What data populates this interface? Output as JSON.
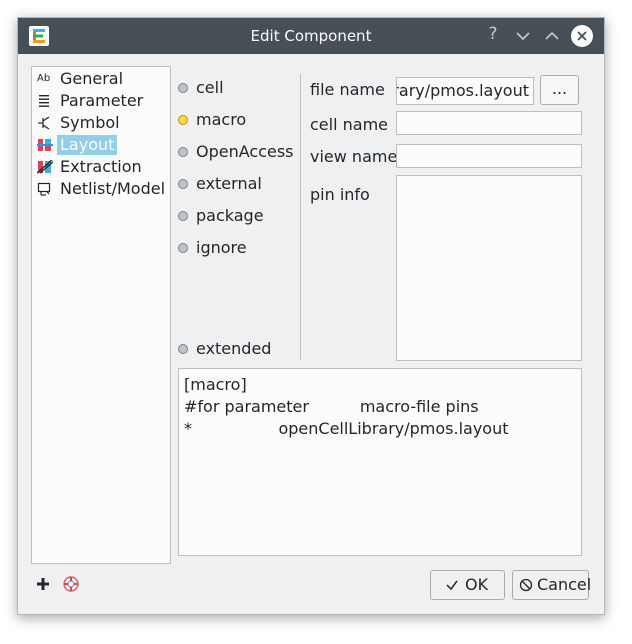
{
  "window": {
    "title": "Edit Component",
    "help_symbol": "?"
  },
  "nav": {
    "items": [
      {
        "label": "General",
        "icon": "ab-text-icon",
        "glyph": "Ab"
      },
      {
        "label": "Parameter",
        "icon": "parameter-list-icon"
      },
      {
        "label": "Symbol",
        "icon": "transistor-symbol-icon"
      },
      {
        "label": "Layout",
        "icon": "layout-icon",
        "selected": true
      },
      {
        "label": "Extraction",
        "icon": "extraction-icon"
      },
      {
        "label": "Netlist/Model",
        "icon": "netlist-model-icon"
      }
    ]
  },
  "view_types": {
    "options": [
      "cell",
      "macro",
      "OpenAccess",
      "external",
      "package",
      "ignore"
    ],
    "extended_label": "extended",
    "selected": "macro"
  },
  "fields": {
    "file_name_label": "file name",
    "file_name_value": "openCellLibrary/pmos.layout",
    "browse_label": "...",
    "cell_name_label": "cell name",
    "cell_name_value": "",
    "view_name_label": "view name",
    "view_name_value": "",
    "pin_info_label": "pin info"
  },
  "macro_text": {
    "line1": "[macro]",
    "line2": "#for parameter          macro-file pins",
    "line3": "*                 openCellLibrary/pmos.layout"
  },
  "buttons": {
    "ok_label": "OK",
    "cancel_label": "Cancel"
  },
  "colors": {
    "titlebar": "#475057",
    "selection": "#93cee9",
    "radio_checked": "#fdd74b"
  }
}
